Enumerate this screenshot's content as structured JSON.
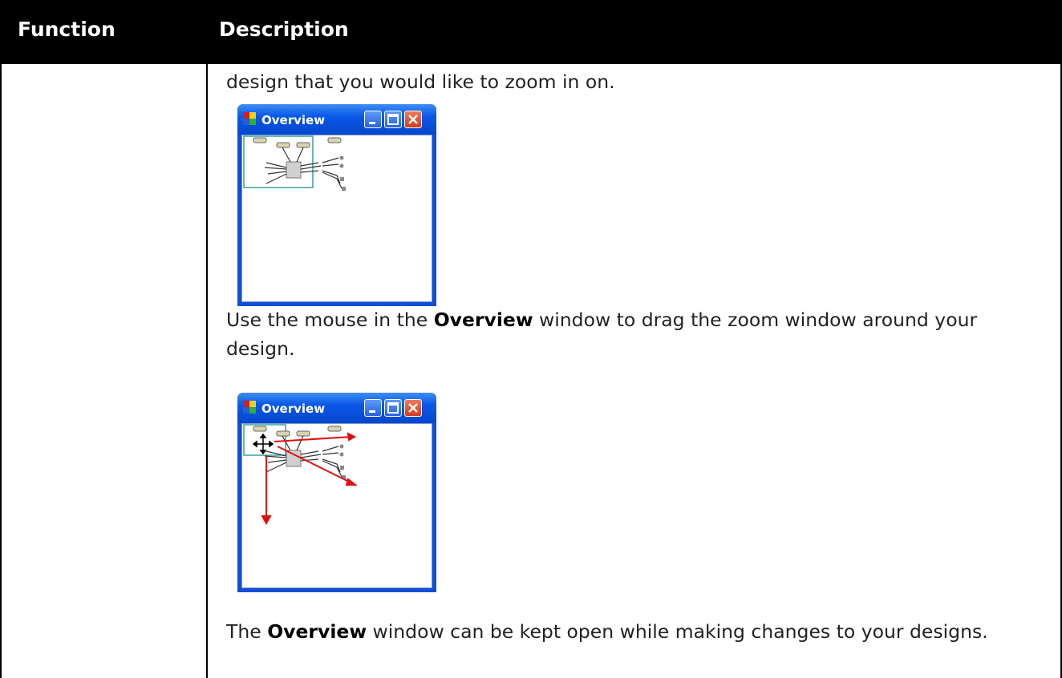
{
  "table": {
    "headers": {
      "function": "Function",
      "description": "Description"
    }
  },
  "content": {
    "paragraph1": "design that you would like to zoom in on.",
    "paragraph2": {
      "before": "Use the mouse in the ",
      "bold": "Overview",
      "after": " window to drag the zoom window around your design."
    },
    "paragraph3": {
      "before": "The ",
      "bold": "Overview",
      "after": " window can be kept open while making changes to your designs."
    }
  },
  "screenshot1": {
    "window_title": "Overview"
  },
  "screenshot2": {
    "window_title": "Overview"
  },
  "colors": {
    "header_bg": "#000000",
    "titlebar_blue": "#0a58e6",
    "zoom_rect": "#3aa0a0",
    "drag_arrow": "#e01010"
  }
}
